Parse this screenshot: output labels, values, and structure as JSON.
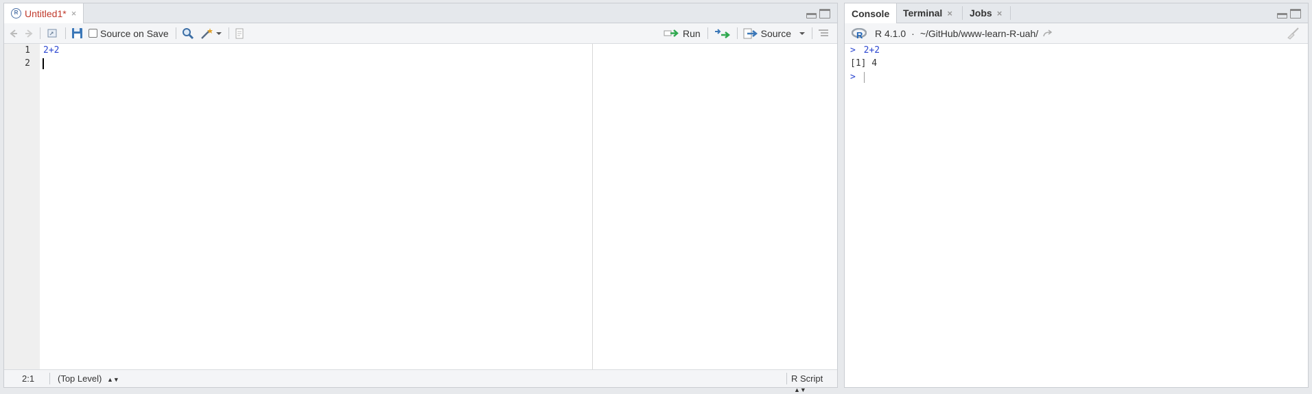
{
  "editor": {
    "tab": {
      "label": "Untitled1*",
      "close": "×"
    },
    "toolbar": {
      "source_on_save": "Source on Save",
      "run": "Run",
      "source": "Source"
    },
    "lines": [
      {
        "num": "1",
        "code": "2+2"
      },
      {
        "num": "2",
        "code": ""
      }
    ],
    "status": {
      "position": "2:1",
      "scope": "(Top Level)",
      "filetype": "R Script"
    }
  },
  "console": {
    "tabs": [
      {
        "label": "Console",
        "close": ""
      },
      {
        "label": "Terminal",
        "close": "×"
      },
      {
        "label": "Jobs",
        "close": "×"
      }
    ],
    "r_version": "R 4.1.0",
    "separator": "·",
    "path": "~/GitHub/www-learn-R-uah/",
    "output": [
      {
        "prompt": ">",
        "text": "2+2"
      },
      {
        "prompt": "",
        "text": "[1] 4"
      },
      {
        "prompt": ">",
        "text": ""
      }
    ]
  },
  "colors": {
    "accent_blue": "#2b46d0",
    "tab_title_red": "#c0392b"
  }
}
